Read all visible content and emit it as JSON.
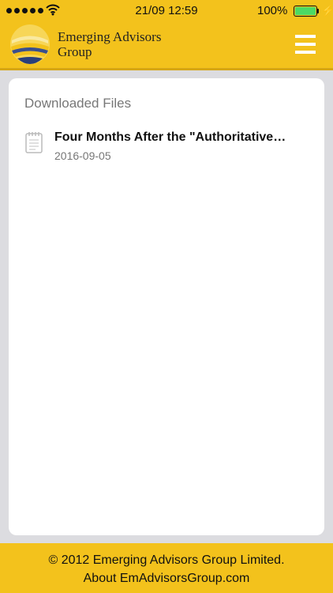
{
  "status_bar": {
    "time": "21/09 12:59",
    "battery_percent": "100%",
    "battery_level": 1.0,
    "signal_bars": 5
  },
  "app_bar": {
    "brand_line1": "Emerging Advisors",
    "brand_line2": "Group",
    "logo_icon": "emerging-advisors-logo",
    "menu_icon": "hamburger-menu-icon"
  },
  "downloads": {
    "title": "Downloaded Files",
    "files": [
      {
        "title": "Four Months After the \"Authoritative…",
        "date": "2016-09-05",
        "icon": "document-icon"
      }
    ]
  },
  "footer": {
    "copyright": "© 2012 Emerging Advisors Group Limited.",
    "link": "About EmAdvisorsGroup.com"
  },
  "colors": {
    "brand_yellow": "#f3c21c",
    "page_background": "#dcdce0",
    "battery_green": "#4cd964"
  }
}
